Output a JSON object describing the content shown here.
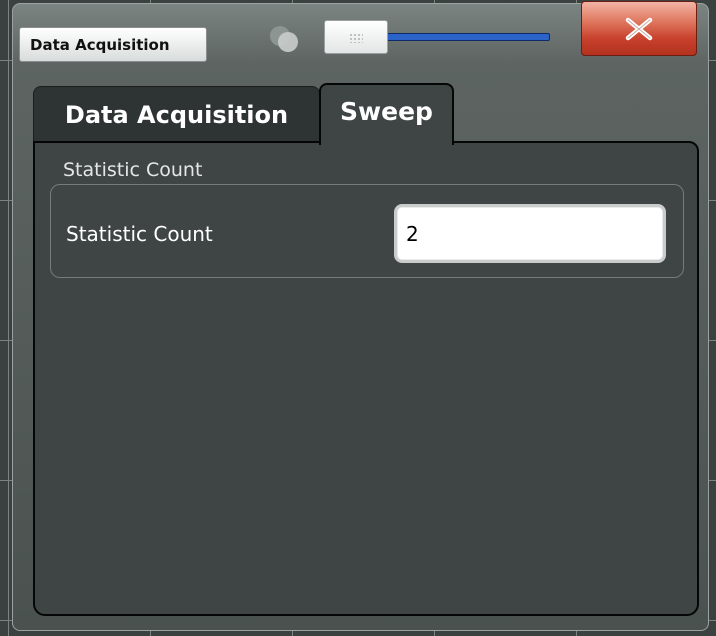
{
  "window": {
    "title": "Data Acquisition",
    "close_label": "X"
  },
  "tabs": [
    {
      "label": "Data Acquisition",
      "active": false
    },
    {
      "label": "Sweep",
      "active": true
    }
  ],
  "sweep": {
    "group_title": "Statistic Count",
    "field_label": "Statistic Count",
    "field_value": "2"
  },
  "icons": {
    "transparency": "transparency-icon",
    "close": "close-icon",
    "grip": "grip-icon"
  },
  "colors": {
    "close_button": "#c7402b",
    "slider_track": "#2c63c8",
    "panel_bg": "#3f4544"
  }
}
